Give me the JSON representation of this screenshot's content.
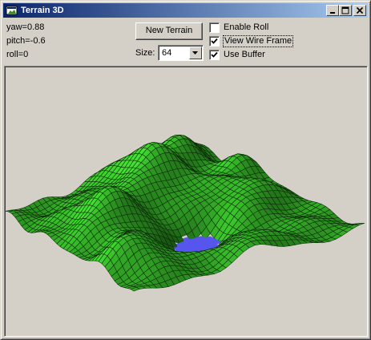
{
  "window": {
    "title": "Terrain 3D",
    "icon": "app-icon",
    "controls": [
      "minimize-icon",
      "maximize-icon",
      "close-icon"
    ]
  },
  "view_info": {
    "yaw": "yaw=0.88",
    "pitch": "pitch=-0.6",
    "roll": "roll=0"
  },
  "toolbar": {
    "new_terrain_label": "New Terrain",
    "size_label": "Size:",
    "size_value": "64"
  },
  "options": [
    {
      "label": "Enable Roll",
      "checked": false
    },
    {
      "label": "View Wire Frame",
      "checked": true,
      "focused": true
    },
    {
      "label": "Use Buffer",
      "checked": true
    }
  ],
  "render": {
    "land_color": "#2e9a22",
    "wire_color": "#0b2a08",
    "water_color": "#5656ee"
  }
}
